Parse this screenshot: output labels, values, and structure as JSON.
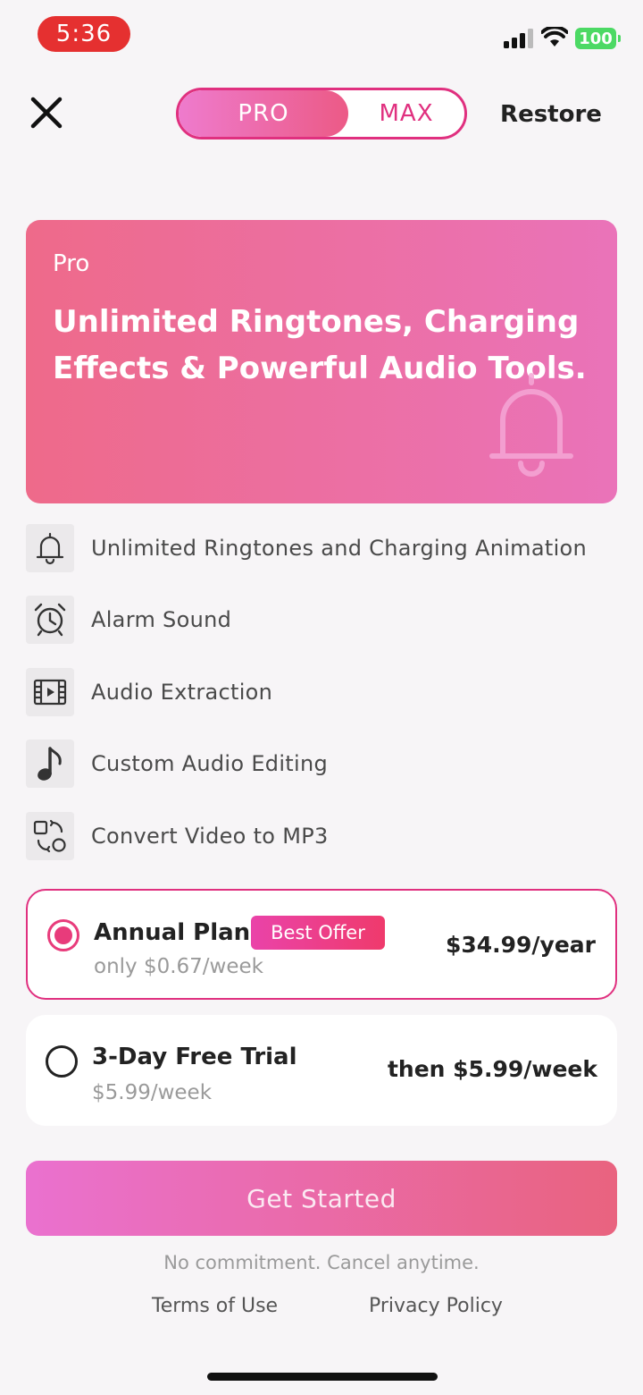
{
  "status_bar": {
    "time": "5:36",
    "battery": "100"
  },
  "header": {
    "close_icon": "close-icon",
    "tabs": [
      {
        "label": "PRO",
        "selected": true
      },
      {
        "label": "MAX",
        "selected": false
      }
    ],
    "restore_label": "Restore"
  },
  "hero": {
    "tag": "Pro",
    "title": "Unlimited Ringtones, Charging Effects & Powerful Audio Tools.",
    "icon": "bell-icon"
  },
  "features": [
    {
      "icon": "bell-icon",
      "label": "Unlimited Ringtones and Charging Animation"
    },
    {
      "icon": "alarm-clock-icon",
      "label": "Alarm Sound"
    },
    {
      "icon": "film-icon",
      "label": "Audio Extraction"
    },
    {
      "icon": "music-note-icon",
      "label": "Custom Audio Editing"
    },
    {
      "icon": "convert-icon",
      "label": "Convert Video to MP3"
    }
  ],
  "plans": [
    {
      "title": "Annual Plan",
      "badge": "Best Offer",
      "subtitle": "only $0.67/week",
      "price": "$34.99/year",
      "selected": true
    },
    {
      "title": "3-Day Free Trial",
      "badge": "",
      "subtitle": "$5.99/week",
      "price": "then $5.99/week",
      "selected": false
    }
  ],
  "cta": {
    "label": "Get Started"
  },
  "footer": {
    "note": "No commitment. Cancel anytime.",
    "terms": "Terms of Use",
    "privacy": "Privacy Policy"
  },
  "colors": {
    "accent": "#e0307f",
    "hero_start": "#ee6a8a",
    "hero_end": "#ea73b9",
    "battery": "#4cd964",
    "time_pill": "#e53030"
  }
}
